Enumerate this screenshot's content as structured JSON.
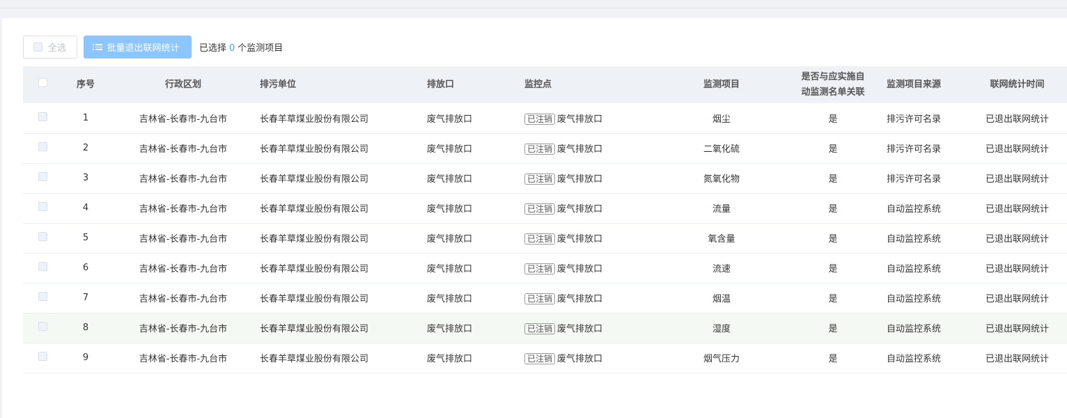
{
  "toolbar": {
    "select_all_label": "全选",
    "batch_exit_label": "批量退出联网统计",
    "selection_prefix": "已选择",
    "selected_count": "0",
    "selection_suffix": "个监测项目"
  },
  "table": {
    "headers": {
      "index": "序号",
      "region": "行政区划",
      "company": "排污单位",
      "outlet": "排放口",
      "monitor_point": "监控点",
      "item": "监测项目",
      "auto_list": "是否与应实施自动监测名单关联",
      "source": "监测项目来源",
      "network_time": "联网统计时间"
    },
    "cancelled_tag": "已注销",
    "rows": [
      {
        "index": "1",
        "region": "吉林省-长春市-九台市",
        "company": "长春羊草煤业股份有限公司",
        "outlet": "废气排放口",
        "monitor_point": "废气排放口",
        "item": "烟尘",
        "auto_list": "是",
        "source": "排污许可名录",
        "network_time": "已退出联网统计"
      },
      {
        "index": "2",
        "region": "吉林省-长春市-九台市",
        "company": "长春羊草煤业股份有限公司",
        "outlet": "废气排放口",
        "monitor_point": "废气排放口",
        "item": "二氧化硫",
        "auto_list": "是",
        "source": "排污许可名录",
        "network_time": "已退出联网统计"
      },
      {
        "index": "3",
        "region": "吉林省-长春市-九台市",
        "company": "长春羊草煤业股份有限公司",
        "outlet": "废气排放口",
        "monitor_point": "废气排放口",
        "item": "氮氧化物",
        "auto_list": "是",
        "source": "排污许可名录",
        "network_time": "已退出联网统计"
      },
      {
        "index": "4",
        "region": "吉林省-长春市-九台市",
        "company": "长春羊草煤业股份有限公司",
        "outlet": "废气排放口",
        "monitor_point": "废气排放口",
        "item": "流量",
        "auto_list": "是",
        "source": "自动监控系统",
        "network_time": "已退出联网统计"
      },
      {
        "index": "5",
        "region": "吉林省-长春市-九台市",
        "company": "长春羊草煤业股份有限公司",
        "outlet": "废气排放口",
        "monitor_point": "废气排放口",
        "item": "氧含量",
        "auto_list": "是",
        "source": "自动监控系统",
        "network_time": "已退出联网统计"
      },
      {
        "index": "6",
        "region": "吉林省-长春市-九台市",
        "company": "长春羊草煤业股份有限公司",
        "outlet": "废气排放口",
        "monitor_point": "废气排放口",
        "item": "流速",
        "auto_list": "是",
        "source": "自动监控系统",
        "network_time": "已退出联网统计"
      },
      {
        "index": "7",
        "region": "吉林省-长春市-九台市",
        "company": "长春羊草煤业股份有限公司",
        "outlet": "废气排放口",
        "monitor_point": "废气排放口",
        "item": "烟温",
        "auto_list": "是",
        "source": "自动监控系统",
        "network_time": "已退出联网统计"
      },
      {
        "index": "8",
        "region": "吉林省-长春市-九台市",
        "company": "长春羊草煤业股份有限公司",
        "outlet": "废气排放口",
        "monitor_point": "废气排放口",
        "item": "湿度",
        "auto_list": "是",
        "source": "自动监控系统",
        "network_time": "已退出联网统计"
      },
      {
        "index": "9",
        "region": "吉林省-长春市-九台市",
        "company": "长春羊草煤业股份有限公司",
        "outlet": "废气排放口",
        "monitor_point": "废气排放口",
        "item": "烟气压力",
        "auto_list": "是",
        "source": "自动监控系统",
        "network_time": "已退出联网统计"
      }
    ]
  }
}
